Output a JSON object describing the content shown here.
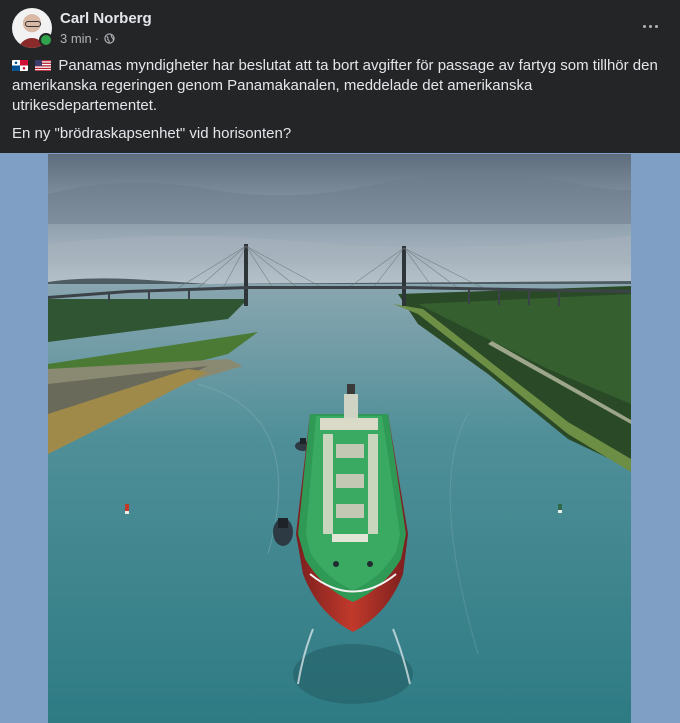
{
  "post": {
    "author": "Carl Norberg",
    "time": "3 min",
    "separator": "·",
    "privacy_icon": "globe-icon",
    "more_icon": "more-dots-icon",
    "flags": [
      "flag-panama-icon",
      "flag-usa-icon"
    ],
    "text_line1": "Panamas myndigheter har beslutat att ta bort avgifter för passage av fartyg som tillhör den amerikanska regeringen genom Panamakanalen, meddelade det amerikanska utrikesdepartementet.",
    "text_line2": "En ny \"brödraskapsenhet\" vid horisonten?"
  },
  "colors": {
    "background": "#242526",
    "text_primary": "#e4e6eb",
    "text_secondary": "#b0b3b8",
    "online": "#31a24c",
    "photo_letterbox": "#7f9fc4"
  }
}
